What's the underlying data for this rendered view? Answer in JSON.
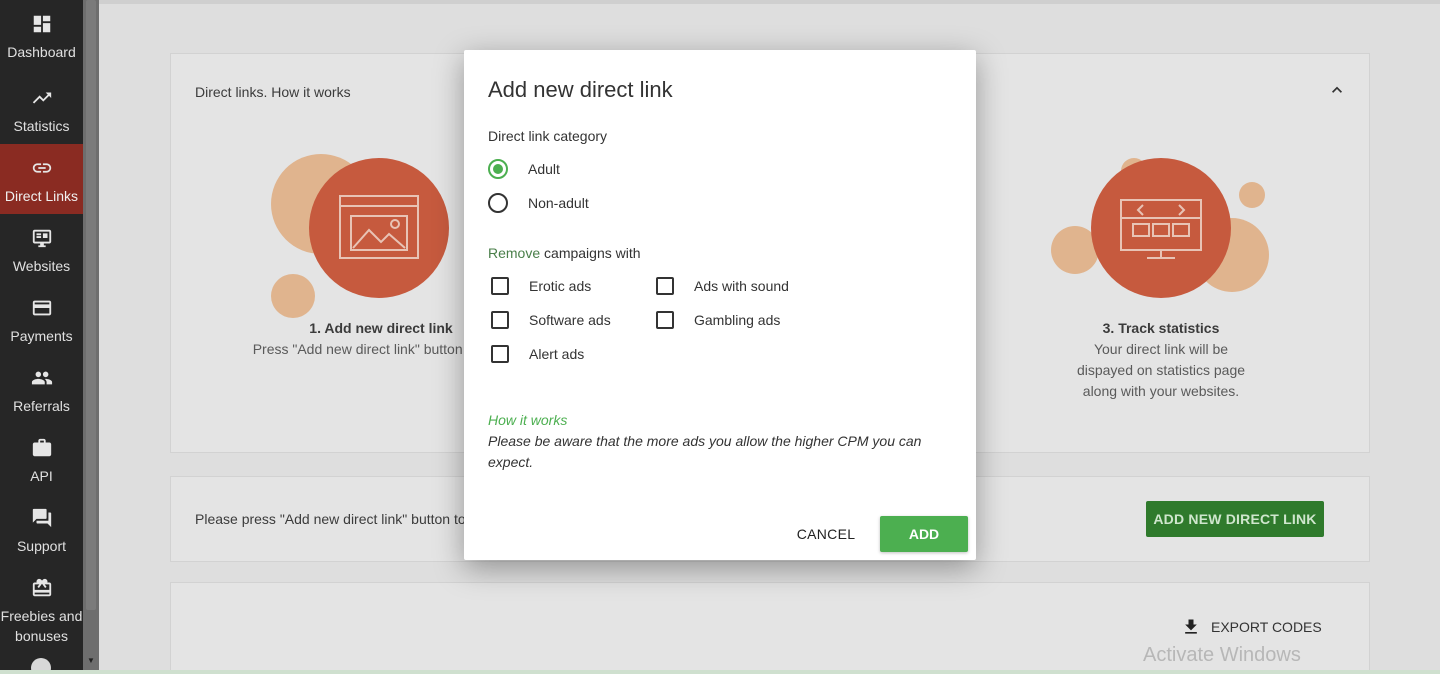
{
  "sidebar": {
    "items": [
      {
        "label": "Dashboard",
        "icon": "dashboard-icon"
      },
      {
        "label": "Statistics",
        "icon": "trending-up-icon"
      },
      {
        "label": "Direct Links",
        "icon": "link-icon",
        "active": true
      },
      {
        "label": "Websites",
        "icon": "web-icon"
      },
      {
        "label": "Payments",
        "icon": "credit-card-icon"
      },
      {
        "label": "Referrals",
        "icon": "people-icon"
      },
      {
        "label": "API",
        "icon": "briefcase-icon"
      },
      {
        "label": "Support",
        "icon": "chat-icon"
      },
      {
        "label": "Freebies and bonuses",
        "icon": "gift-icon"
      }
    ]
  },
  "how_it_works_card": {
    "title": "Direct links. How it works",
    "step1": {
      "title": "1. Add new direct link",
      "text": "Press \"Add new direct link\" button to start"
    },
    "step3": {
      "title": "3. Track statistics",
      "text": "Your direct link will be dispayed on statistics page along with your websites."
    }
  },
  "add_card": {
    "text": "Please press \"Add new direct link\" button to",
    "button": "ADD NEW DIRECT LINK"
  },
  "codes_card": {
    "export_button": "EXPORT CODES"
  },
  "watermark": "Activate Windows",
  "modal": {
    "title": "Add new direct link",
    "category_label": "Direct link category",
    "categories": [
      {
        "label": "Adult",
        "checked": true
      },
      {
        "label": "Non-adult",
        "checked": false
      }
    ],
    "remove_label_prefix": "Remove",
    "remove_label_suffix": " campaigns with",
    "remove_options": [
      {
        "label": "Erotic ads",
        "checked": false
      },
      {
        "label": "Ads with sound",
        "checked": false
      },
      {
        "label": "Software ads",
        "checked": false
      },
      {
        "label": "Gambling ads",
        "checked": false
      },
      {
        "label": "Alert ads",
        "checked": false
      }
    ],
    "how_title": "How it works",
    "how_text": "Please be aware that the more ads you allow the higher CPM you can expect.",
    "cancel_label": "CANCEL",
    "add_label": "ADD"
  },
  "colors": {
    "accent_green": "#4caf50",
    "sidebar_bg": "#262626",
    "active_nav": "#8a2b22",
    "illustration": "#c65a3e"
  }
}
